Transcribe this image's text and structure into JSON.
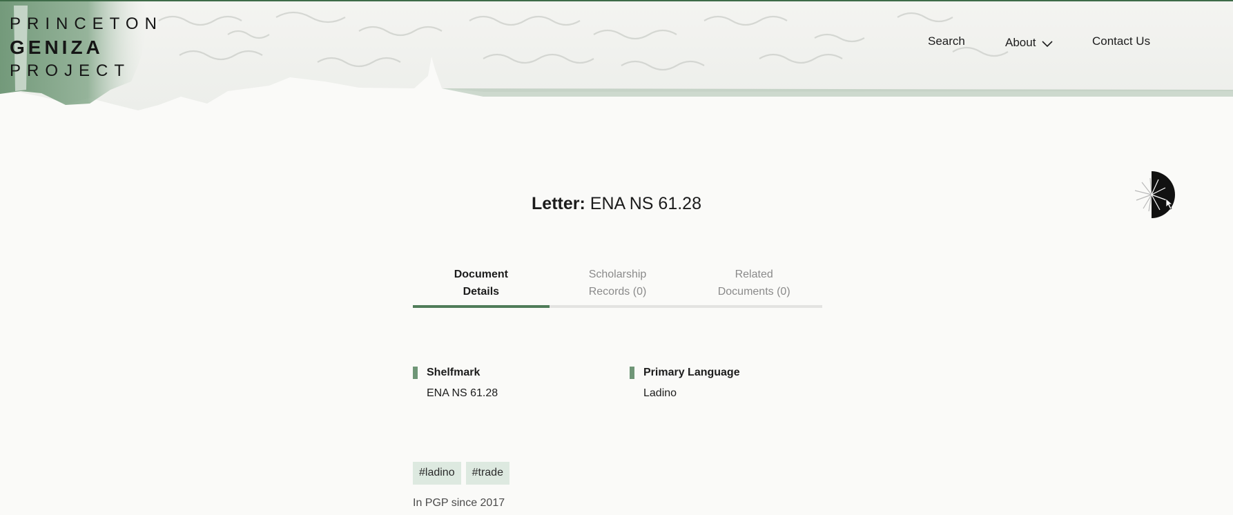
{
  "header": {
    "logo": {
      "line1": "PRINCETON",
      "line2": "GENIZA",
      "line3": "PROJECT"
    },
    "nav": {
      "search": "Search",
      "about": "About",
      "contact": "Contact Us"
    }
  },
  "document": {
    "type_label": "Letter:",
    "shelfmark_title": "ENA NS 61.28"
  },
  "tabs": [
    {
      "label": "Document Details",
      "line1": "Document",
      "line2": "Details",
      "active": true
    },
    {
      "label": "Scholarship Records (0)",
      "line1": "Scholarship",
      "line2": "Records (0)",
      "active": false
    },
    {
      "label": "Related Documents (0)",
      "line1": "Related",
      "line2": "Documents (0)",
      "active": false
    }
  ],
  "fields": {
    "shelfmark": {
      "label": "Shelfmark",
      "value": "ENA NS 61.28"
    },
    "language": {
      "label": "Primary Language",
      "value": "Ladino"
    }
  },
  "tags": [
    "#ladino",
    "#trade"
  ],
  "since": "In PGP since 2017",
  "colors": {
    "accent": "#4f7c59",
    "tag_bg": "#dde9e0",
    "marker": "#6f9677",
    "top_rule": "#3e6b48"
  },
  "icons": {
    "about_chevron": "chevron-down-icon",
    "loader": "loading-spinner-icon"
  }
}
